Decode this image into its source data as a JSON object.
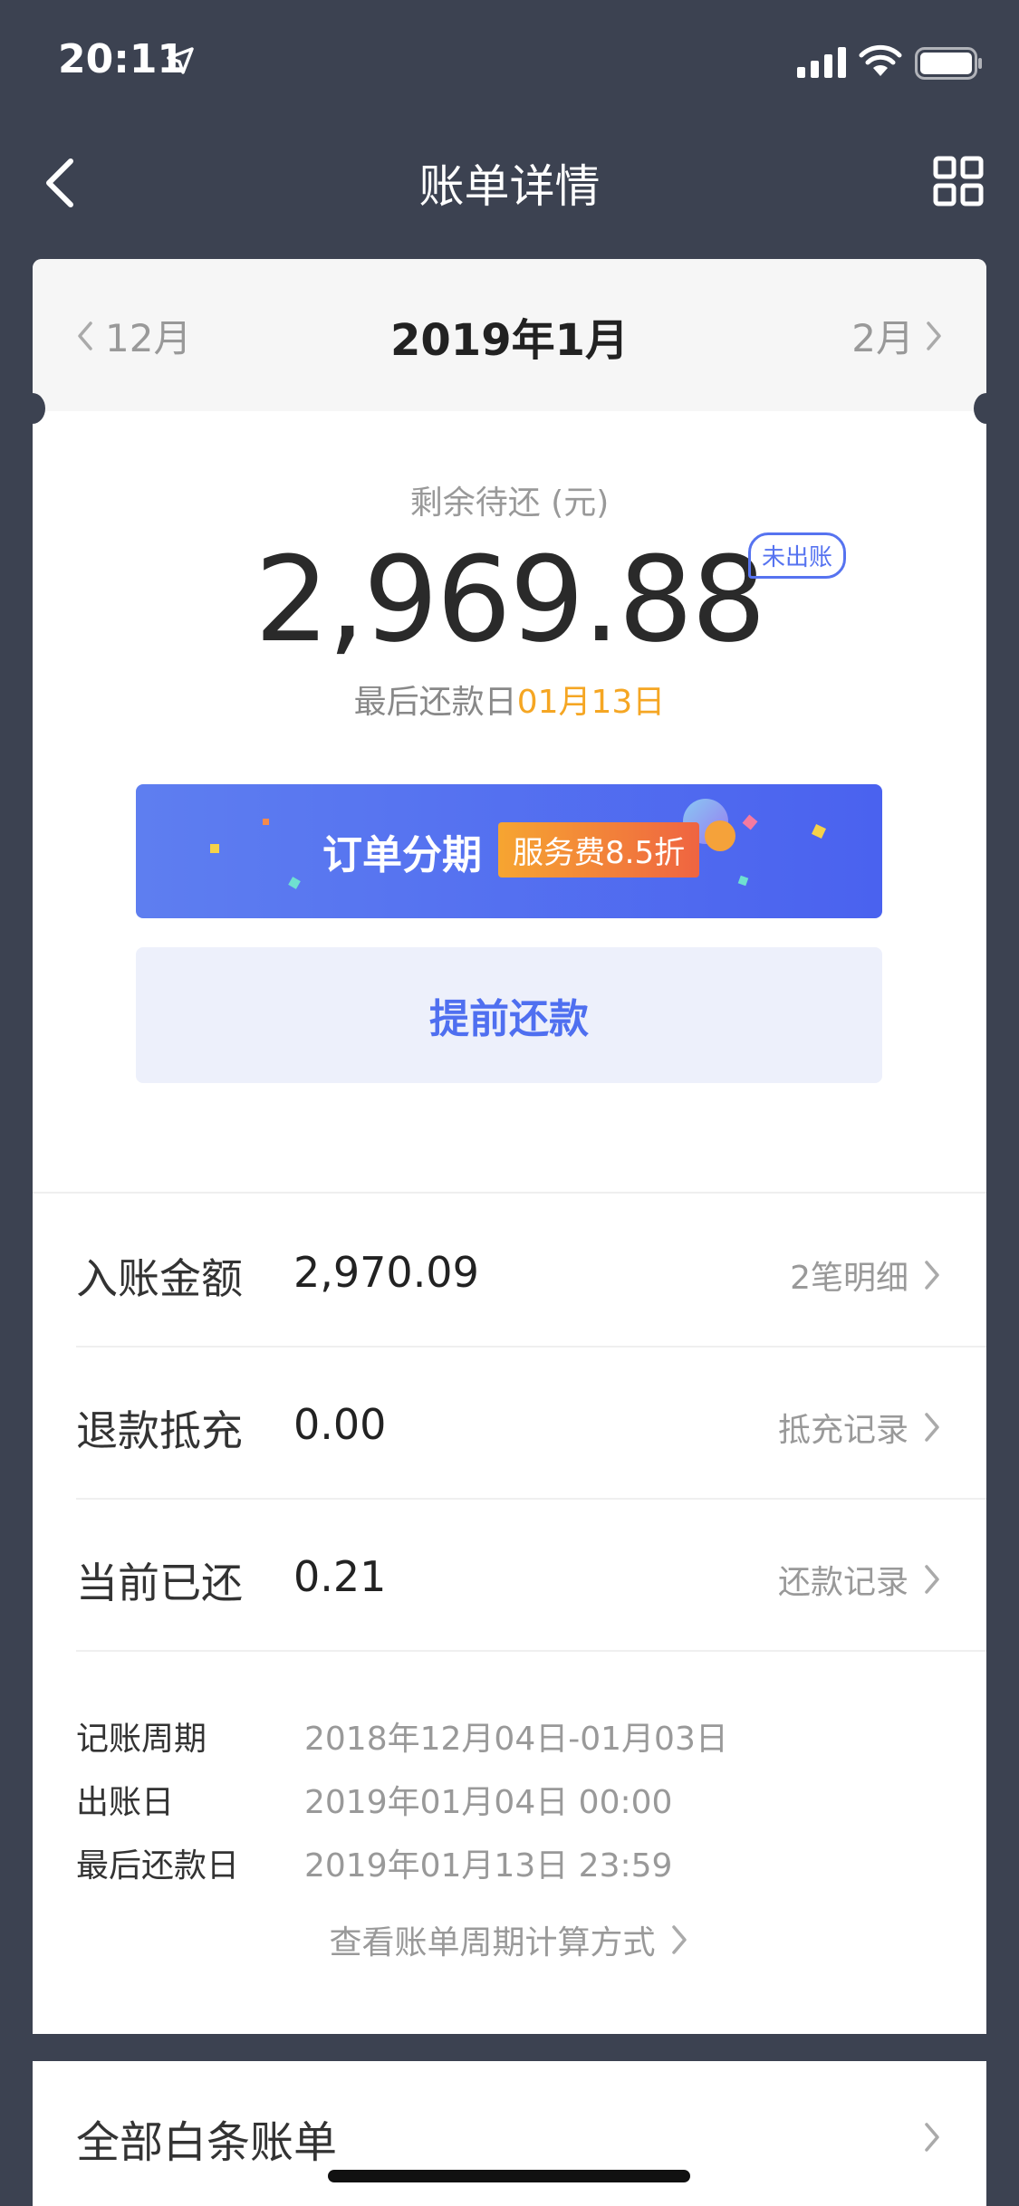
{
  "status_bar": {
    "time": "20:11"
  },
  "nav": {
    "title": "账单详情"
  },
  "month": {
    "prev": "12月",
    "current": "2019年1月",
    "next": "2月"
  },
  "summary": {
    "label": "剩余待还 (元)",
    "amount": "2,969.88",
    "badge": "未出账",
    "due_prefix": "最后还款日",
    "due_date": "01月13日"
  },
  "buttons": {
    "installment": "订单分期",
    "fee_badge": "服务费8.5折",
    "prepay": "提前还款"
  },
  "rows": [
    {
      "label": "入账金额",
      "value": "2,970.09",
      "link": "2笔明细"
    },
    {
      "label": "退款抵充",
      "value": "0.00",
      "link": "抵充记录"
    },
    {
      "label": "当前已还",
      "value": "0.21",
      "link": "还款记录"
    }
  ],
  "info": [
    {
      "key": "记账周期",
      "value": "2018年12月04日-01月03日"
    },
    {
      "key": "出账日",
      "value": "2019年01月04日  00:00"
    },
    {
      "key": "最后还款日",
      "value": "2019年01月13日  23:59"
    }
  ],
  "calc_link": "查看账单周期计算方式",
  "all_bills": "全部白条账单",
  "colors": {
    "background": "#3c4251",
    "accent_blue": "#5673f0",
    "due_orange": "#f5a623"
  }
}
